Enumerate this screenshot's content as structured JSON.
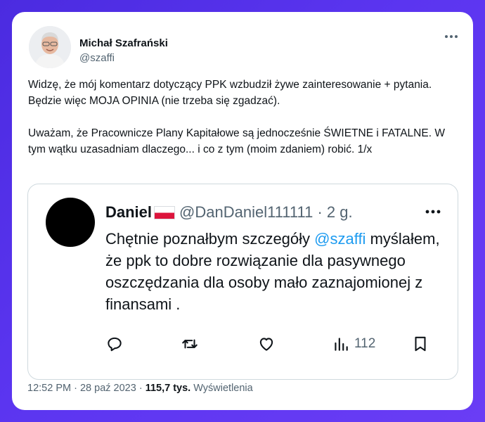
{
  "tweet": {
    "author": {
      "name": "Michał Szafrański",
      "handle": "@szaffi"
    },
    "paragraphs": [
      "Widzę, że mój komentarz dotyczący PPK wzbudził żywe zainteresowanie + pytania. Będzie więc MOJA OPINIA (nie trzeba się zgadzać).",
      "Uważam, że Pracownicze Plany Kapitałowe są jednocześnie ŚWIETNE i FATALNE. W tym wątku uzasadniam dlaczego... i co z tym (moim zdaniem) robić. 1/x"
    ],
    "footer": {
      "time": "12:52 PM",
      "separator": " · ",
      "date": "28 paź 2023",
      "views_value": "115,7 tys.",
      "views_label": "Wyświetlenia"
    }
  },
  "quote": {
    "name": "Daniel",
    "flag_icon": "flag-poland",
    "handle_time": "@DanDaniel111111 · 2 g.",
    "text_before": "Chętnie poznałbym szczegóły ",
    "mention": "@szaffi",
    "text_after": " myślałem, że ppk to dobre rozwiązanie dla pasywnego oszczędzania dla osoby mało zaznajomionej z finansami .",
    "actions": {
      "reply_icon": "reply-icon",
      "retweet_icon": "retweet-icon",
      "like_icon": "heart-icon",
      "views_icon": "bar-chart-icon",
      "views_count": "112",
      "bookmark_icon": "bookmark-icon"
    }
  },
  "colors": {
    "background": "#5533ea",
    "text": "#0f1419",
    "secondary": "#536471",
    "link": "#1d9bf0",
    "border": "#cfd9de"
  }
}
